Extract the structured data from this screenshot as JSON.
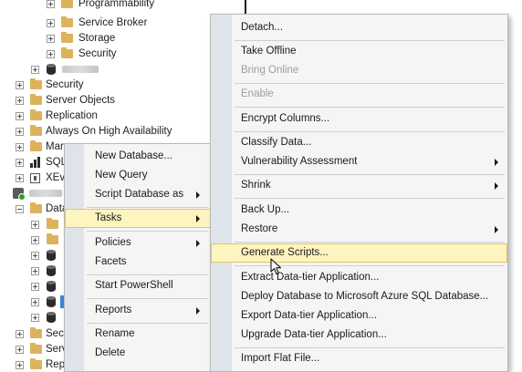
{
  "object_explorer": {
    "items": [
      {
        "label": "Programmability"
      },
      {
        "label": "Service Broker"
      },
      {
        "label": "Storage"
      },
      {
        "label": "Security"
      },
      {
        "label": ""
      },
      {
        "label": "Security"
      },
      {
        "label": "Server Objects"
      },
      {
        "label": "Replication"
      },
      {
        "label": "Always On High Availability"
      },
      {
        "label": "Mar"
      },
      {
        "label": "SQL"
      },
      {
        "label": "XEve"
      },
      {
        "label": ""
      },
      {
        "label": "Data"
      },
      {
        "label": "Secu"
      },
      {
        "label": "Serv"
      },
      {
        "label": "Repl"
      }
    ]
  },
  "context_menu": {
    "items": [
      {
        "label": "New Database...",
        "has_submenu": false
      },
      {
        "label": "New Query",
        "has_submenu": false
      },
      {
        "label": "Script Database as",
        "has_submenu": true
      },
      {
        "label": "Tasks",
        "has_submenu": true,
        "highlighted": true
      },
      {
        "label": "Policies",
        "has_submenu": true
      },
      {
        "label": "Facets",
        "has_submenu": false
      },
      {
        "label": "Start PowerShell",
        "has_submenu": false
      },
      {
        "label": "Reports",
        "has_submenu": true
      },
      {
        "label": "Rename",
        "has_submenu": false
      },
      {
        "label": "Delete",
        "has_submenu": false
      }
    ]
  },
  "tasks_submenu": {
    "items": [
      {
        "label": "Detach...",
        "enabled": true,
        "has_submenu": false
      },
      {
        "label": "Take Offline",
        "enabled": true,
        "has_submenu": false
      },
      {
        "label": "Bring Online",
        "enabled": false,
        "has_submenu": false
      },
      {
        "label": "Enable",
        "enabled": false,
        "has_submenu": false
      },
      {
        "label": "Encrypt Columns...",
        "enabled": true,
        "has_submenu": false
      },
      {
        "label": "Classify Data...",
        "enabled": true,
        "has_submenu": false
      },
      {
        "label": "Vulnerability Assessment",
        "enabled": true,
        "has_submenu": true
      },
      {
        "label": "Shrink",
        "enabled": true,
        "has_submenu": true
      },
      {
        "label": "Back Up...",
        "enabled": true,
        "has_submenu": false
      },
      {
        "label": "Restore",
        "enabled": true,
        "has_submenu": true
      },
      {
        "label": "Generate Scripts...",
        "enabled": true,
        "has_submenu": false,
        "highlighted": true
      },
      {
        "label": "Extract Data-tier Application...",
        "enabled": true,
        "has_submenu": false
      },
      {
        "label": "Deploy Database to Microsoft Azure SQL Database...",
        "enabled": true,
        "has_submenu": false
      },
      {
        "label": "Export Data-tier Application...",
        "enabled": true,
        "has_submenu": false
      },
      {
        "label": "Upgrade Data-tier Application...",
        "enabled": true,
        "has_submenu": false
      },
      {
        "label": "Import Flat File...",
        "enabled": true,
        "has_submenu": false
      }
    ]
  },
  "colors": {
    "menu_bg": "#f5f5f5",
    "menu_gutter": "#dfe4ea",
    "highlight_bg": "#fdf4bf",
    "highlight_border": "#e5c365",
    "disabled_text": "#9d9d9d",
    "folder": "#dcb35c"
  }
}
